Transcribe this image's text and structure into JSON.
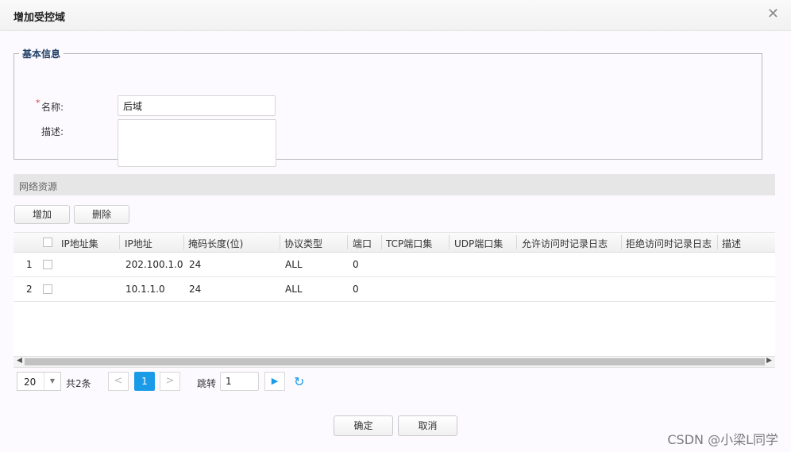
{
  "dialog": {
    "title": "增加受控域",
    "close_glyph": "✕"
  },
  "basic": {
    "legend": "基本信息",
    "name_required_mark": "*",
    "name_label": "名称:",
    "name_value": "后域",
    "desc_label": "描述:",
    "desc_value": ""
  },
  "network": {
    "section_title": "网络资源",
    "add_label": "增加",
    "delete_label": "删除",
    "columns": [
      "IP地址集",
      "IP地址",
      "掩码长度(位)",
      "协议类型",
      "端口",
      "TCP端口集",
      "UDP端口集",
      "允许访问时记录日志",
      "拒绝访问时记录日志",
      "描述"
    ],
    "rows": [
      {
        "index": "1",
        "ip_set": "",
        "ip": "202.100.1.0",
        "mask": "24",
        "protocol": "ALL",
        "port": "0",
        "tcp": "",
        "udp": "",
        "allow_log": "",
        "deny_log": "",
        "desc": ""
      },
      {
        "index": "2",
        "ip_set": "",
        "ip": "10.1.1.0",
        "mask": "24",
        "protocol": "ALL",
        "port": "0",
        "tcp": "",
        "udp": "",
        "allow_log": "",
        "deny_log": "",
        "desc": ""
      }
    ]
  },
  "pager": {
    "page_size": "20",
    "total": "共2条",
    "prev_glyph": "<",
    "current_page": "1",
    "next_glyph": ">",
    "jump_label": "跳转",
    "jump_value": "1",
    "go_glyph": "▶",
    "refresh_glyph": "↻"
  },
  "footer": {
    "ok_label": "确定",
    "cancel_label": "取消"
  },
  "watermark": "CSDN @小梁L同学",
  "colors": {
    "accent": "#1a9be8",
    "required": "#e03b3b",
    "legend": "#1f3f66"
  }
}
